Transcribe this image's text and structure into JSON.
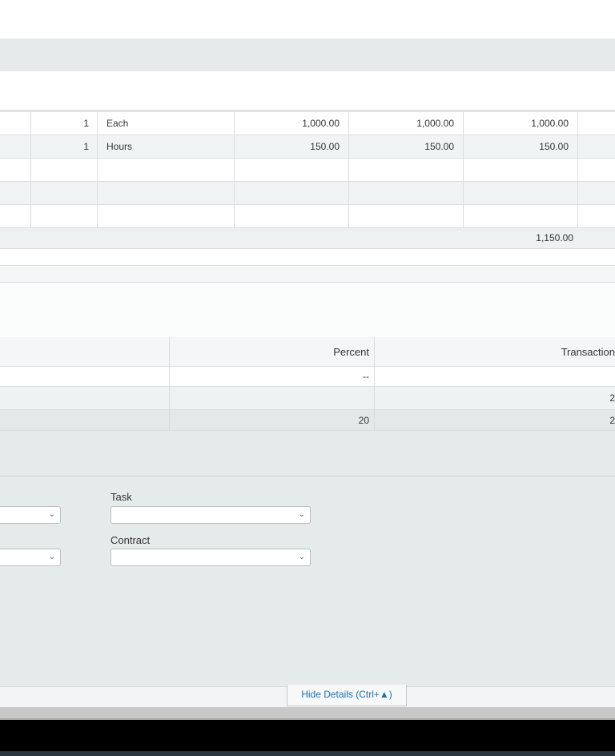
{
  "lines": [
    {
      "qty": "1",
      "unit": "Each",
      "price": "1,000.00",
      "amount": "1,000.00",
      "total": "1,000.00"
    },
    {
      "qty": "1",
      "unit": "Hours",
      "price": "150.00",
      "amount": "150.00",
      "total": "150.00"
    },
    {
      "qty": "",
      "unit": "",
      "price": "",
      "amount": "",
      "total": ""
    },
    {
      "qty": "",
      "unit": "",
      "price": "",
      "amount": "",
      "total": ""
    },
    {
      "qty": "",
      "unit": "",
      "price": "",
      "amount": "",
      "total": ""
    }
  ],
  "lines_total": "1,150.00",
  "tax_table": {
    "headers": {
      "percent": "Percent",
      "transaction": "Transaction"
    },
    "rows": [
      {
        "percent": "--",
        "transaction": ""
      },
      {
        "percent": "",
        "transaction": "2"
      },
      {
        "percent": "20",
        "transaction": "2"
      }
    ]
  },
  "details": {
    "task_label": "Task",
    "contract_label": "Contract",
    "task_value": "",
    "contract_value": "",
    "chevron_glyph": "⌄"
  },
  "footer": {
    "hide_details_label": "Hide Details (Ctrl+▲)"
  },
  "colors": {
    "panel_gray": "#e5eaeb",
    "link_blue": "#1f6fb2",
    "taskbar": "#000000"
  }
}
